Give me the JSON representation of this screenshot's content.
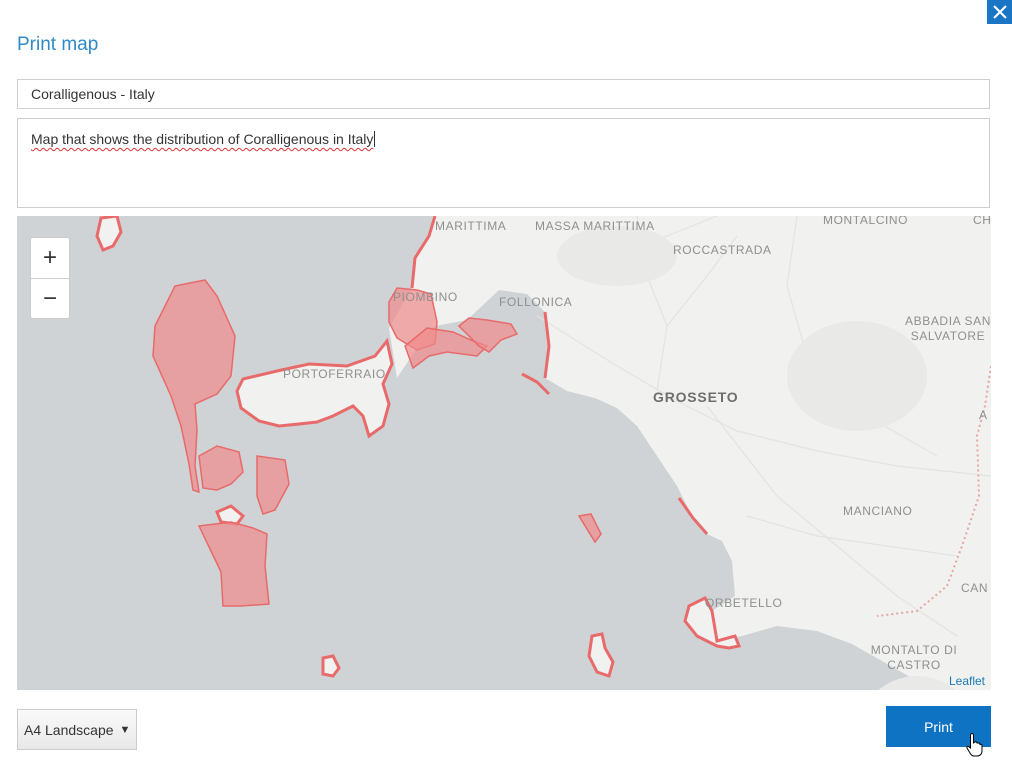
{
  "dialog": {
    "title": "Print map",
    "close_icon": "close-icon"
  },
  "form": {
    "title_value": "Coralligenous - Italy",
    "description_value": "Map that shows the distribution of Coralligenous in Italy"
  },
  "map": {
    "zoom_in": "+",
    "zoom_out": "−",
    "attribution": "Leaflet",
    "labels": {
      "marittima": "MARITTIMA",
      "massa_marittima": "MASSA MARITTIMA",
      "montalcino": "MONTALCINO",
      "ch": "CH",
      "roccastrada": "ROCCASTRADA",
      "piombino": "PIOMBINO",
      "follonica": "FOLLONICA",
      "abbadia": "ABBADIA SAN SALVATORE",
      "portoferraio": "PORTOFERRAIO",
      "grosseto": "GROSSETO",
      "a": "A",
      "manciano": "MANCIANO",
      "can": "CAN",
      "orbetello": "ORBETELLO",
      "montalto": "MONTALTO DI CASTRO"
    },
    "colors": {
      "sea": "#cfd3d6",
      "land": "#f1f1f0",
      "habitat_fill": "#f08a8a",
      "habitat_stroke": "#e86a6a"
    }
  },
  "footer": {
    "format_value": "A4 Landscape",
    "print_label": "Print"
  }
}
